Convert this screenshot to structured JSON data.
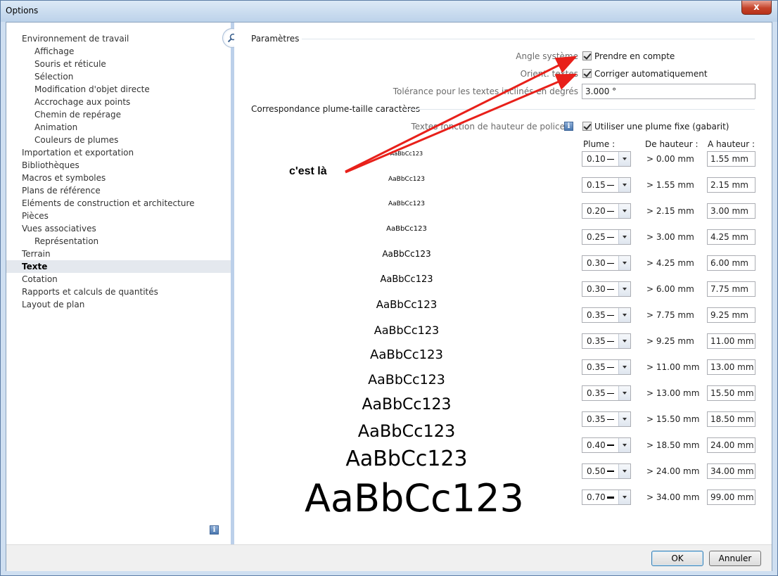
{
  "window": {
    "title": "Options",
    "close_label": "x"
  },
  "sidebar": {
    "items": [
      {
        "label": "Environnement de travail",
        "level": 0
      },
      {
        "label": "Affichage",
        "level": 1
      },
      {
        "label": "Souris et réticule",
        "level": 1
      },
      {
        "label": "Sélection",
        "level": 1
      },
      {
        "label": "Modification d'objet directe",
        "level": 1
      },
      {
        "label": "Accrochage aux points",
        "level": 1
      },
      {
        "label": "Chemin de repérage",
        "level": 1
      },
      {
        "label": "Animation",
        "level": 1
      },
      {
        "label": "Couleurs de plumes",
        "level": 1
      },
      {
        "label": "Importation et exportation",
        "level": 0
      },
      {
        "label": "Bibliothèques",
        "level": 0
      },
      {
        "label": "Macros et symboles",
        "level": 0
      },
      {
        "label": "Plans de référence",
        "level": 0
      },
      {
        "label": "Eléments de construction et architecture",
        "level": 0
      },
      {
        "label": "Pièces",
        "level": 0
      },
      {
        "label": "Vues associatives",
        "level": 0
      },
      {
        "label": "Représentation",
        "level": 1
      },
      {
        "label": "Terrain",
        "level": 0
      },
      {
        "label": "Texte",
        "level": 0,
        "selected": true
      },
      {
        "label": "Cotation",
        "level": 0
      },
      {
        "label": "Rapports et calculs de quantités",
        "level": 0
      },
      {
        "label": "Layout de plan",
        "level": 0
      }
    ],
    "info_glyph": "i"
  },
  "params": {
    "section_title": "Paramètres",
    "angle_label": "Angle système",
    "angle_check": "Prendre en compte",
    "orient_label": "Orient. textes",
    "orient_check": "Corriger automatiquement",
    "tolerance_label": "Tolérance pour les textes inclinés en degrés",
    "tolerance_value": "3.000 °"
  },
  "pen_size": {
    "section_title": "Correspondance plume-taille caractères",
    "font_label": "Textes fonction de hauteur de police",
    "info_glyph": "i",
    "fixed_check": "Utiliser une plume fixe (gabarit)",
    "col_pen": "Plume :",
    "col_from": "De hauteur :",
    "col_to": "A hauteur :",
    "sample_text": "AaBbCc123",
    "rows": [
      {
        "pen": "0.10",
        "from": "> 0.00 mm",
        "to": "1.55 mm"
      },
      {
        "pen": "0.15",
        "from": "> 1.55 mm",
        "to": "2.15 mm"
      },
      {
        "pen": "0.20",
        "from": "> 2.15 mm",
        "to": "3.00 mm"
      },
      {
        "pen": "0.25",
        "from": "> 3.00 mm",
        "to": "4.25 mm"
      },
      {
        "pen": "0.30",
        "from": "> 4.25 mm",
        "to": "6.00 mm"
      },
      {
        "pen": "0.30",
        "from": "> 6.00 mm",
        "to": "7.75 mm"
      },
      {
        "pen": "0.35",
        "from": "> 7.75 mm",
        "to": "9.25 mm"
      },
      {
        "pen": "0.35",
        "from": "> 9.25 mm",
        "to": "11.00 mm"
      },
      {
        "pen": "0.35",
        "from": "> 11.00 mm",
        "to": "13.00 mm"
      },
      {
        "pen": "0.35",
        "from": "> 13.00 mm",
        "to": "15.50 mm"
      },
      {
        "pen": "0.35",
        "from": "> 15.50 mm",
        "to": "18.50 mm"
      },
      {
        "pen": "0.40",
        "from": "> 18.50 mm",
        "to": "24.00 mm"
      },
      {
        "pen": "0.50",
        "from": "> 24.00 mm",
        "to": "34.00 mm"
      },
      {
        "pen": "0.70",
        "from": "> 34.00 mm",
        "to": "99.00 mm"
      }
    ]
  },
  "annotation": {
    "text": "c'est là",
    "arrow_color": "#e8201a"
  },
  "footer": {
    "ok_label": "OK",
    "cancel_label": "Annuler"
  },
  "colors": {
    "selected_bg": "#e4e8ee",
    "splitter": "#bcd0ea",
    "window_frame": "#cfdff1"
  }
}
